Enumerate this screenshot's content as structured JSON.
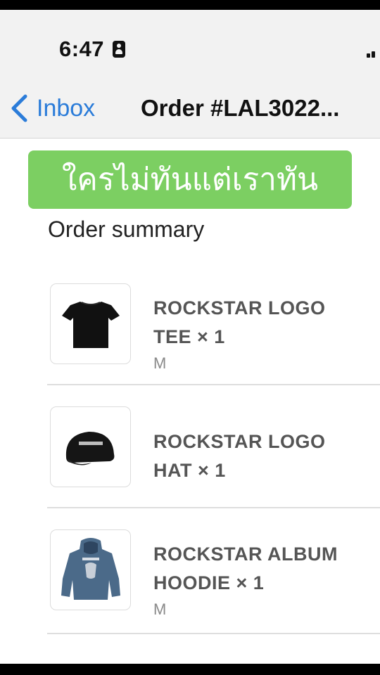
{
  "status_bar": {
    "time": "6:47"
  },
  "nav": {
    "back_label": "Inbox",
    "title": "Order #LAL3022..."
  },
  "banner": {
    "text": "ใครไม่ทันแต่เราทัน"
  },
  "summary": {
    "title": "Order summary"
  },
  "items": [
    {
      "name": "ROCKSTAR LOGO TEE × 1",
      "variant": "M",
      "icon": "tshirt-icon"
    },
    {
      "name": "ROCKSTAR LOGO HAT × 1",
      "variant": "",
      "icon": "cap-icon"
    },
    {
      "name": "ROCKSTAR ALBUM HOODIE × 1",
      "variant": "M",
      "icon": "hoodie-icon"
    }
  ],
  "colors": {
    "accent": "#2b7cd9",
    "banner": "#7ccf62",
    "hoodie": "#4b6a89"
  }
}
